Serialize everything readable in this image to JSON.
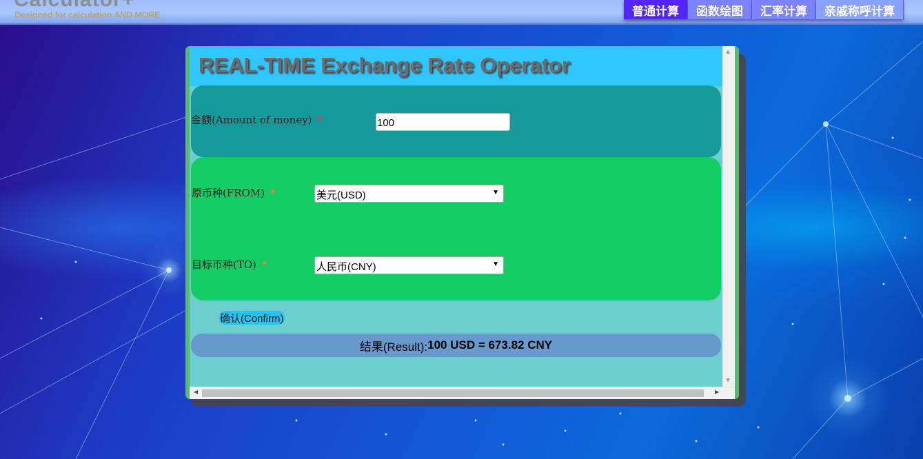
{
  "header": {
    "logo_title": "Calculator+",
    "logo_subtitle": "Designed for calculation AND MORE"
  },
  "nav": {
    "items": [
      {
        "label": "普通计算",
        "active": true
      },
      {
        "label": "函数绘图",
        "active": false
      },
      {
        "label": "汇率计算",
        "active": false
      },
      {
        "label": "亲戚称呼计算",
        "active": false
      }
    ]
  },
  "panel": {
    "title": "REAL-TIME Exchange Rate Operator",
    "amount": {
      "label": "金额(Amount of money)",
      "required_mark": "*",
      "value": "100"
    },
    "from": {
      "label": "原币种(FROM)",
      "required_mark": "*",
      "selected": "美元(USD)"
    },
    "to": {
      "label": "目标币种(TO)",
      "required_mark": "*",
      "selected": "人民币(CNY)"
    },
    "confirm_label": "确认(Confirm)",
    "result": {
      "prefix": "结果(Result):",
      "value": "100 USD = 673.82 CNY"
    }
  },
  "colors": {
    "nav_active": "#5524ff",
    "nav_item": "#7b83ff",
    "title_bar": "#30c6ff",
    "amount_box": "#15999b",
    "currency_box": "#12cd63",
    "result_bar": "#6899cd",
    "panel_bg": "#6ccfcd"
  }
}
